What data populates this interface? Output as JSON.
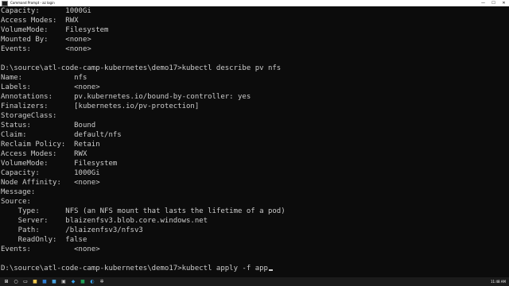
{
  "window": {
    "title": "Command Prompt - az login",
    "controls": {
      "minimize": "—",
      "maximize": "☐",
      "close": "✕"
    }
  },
  "terminal": {
    "lines": [
      "Capacity:      1000Gi",
      "Access Modes:  RWX",
      "VolumeMode:    Filesystem",
      "Mounted By:    <none>",
      "Events:        <none>",
      "",
      "D:\\source\\atl-code-camp-kubernetes\\demo17>kubectl describe pv nfs",
      "Name:            nfs",
      "Labels:          <none>",
      "Annotations:     pv.kubernetes.io/bound-by-controller: yes",
      "Finalizers:      [kubernetes.io/pv-protection]",
      "StorageClass:",
      "Status:          Bound",
      "Claim:           default/nfs",
      "Reclaim Policy:  Retain",
      "Access Modes:    RWX",
      "VolumeMode:      Filesystem",
      "Capacity:        1000Gi",
      "Node Affinity:   <none>",
      "Message:",
      "Source:",
      "    Type:      NFS (an NFS mount that lasts the lifetime of a pod)",
      "    Server:    blaizenfsv3.blob.core.windows.net",
      "    Path:      /blaizenfsv3/nfsv3",
      "    ReadOnly:  false",
      "Events:          <none>",
      ""
    ],
    "prompt": "D:\\source\\atl-code-camp-kubernetes\\demo17>",
    "command": "kubectl apply -f app"
  },
  "taskbar": {
    "icons": [
      {
        "name": "start-icon",
        "glyph": "⊞",
        "color": "#ffffff"
      },
      {
        "name": "search-icon",
        "glyph": "○",
        "color": "#ffffff"
      },
      {
        "name": "task-view-icon",
        "glyph": "▭",
        "color": "#ffffff"
      },
      {
        "name": "file-explorer-icon",
        "glyph": "■",
        "color": "#f2c94c"
      },
      {
        "name": "mail-icon",
        "glyph": "■",
        "color": "#2d7dd2"
      },
      {
        "name": "store-icon",
        "glyph": "■",
        "color": "#4aa3df"
      },
      {
        "name": "command-prompt-icon",
        "glyph": "▣",
        "color": "#cccccc"
      },
      {
        "name": "visual-studio-code-icon",
        "glyph": "◆",
        "color": "#3aa0e8"
      },
      {
        "name": "excel-icon",
        "glyph": "■",
        "color": "#1f9d55"
      },
      {
        "name": "edge-icon",
        "glyph": "◐",
        "color": "#3aa0e8"
      },
      {
        "name": "settings-icon",
        "glyph": "✲",
        "color": "#dddddd"
      }
    ],
    "clock": "11:48 AM"
  }
}
